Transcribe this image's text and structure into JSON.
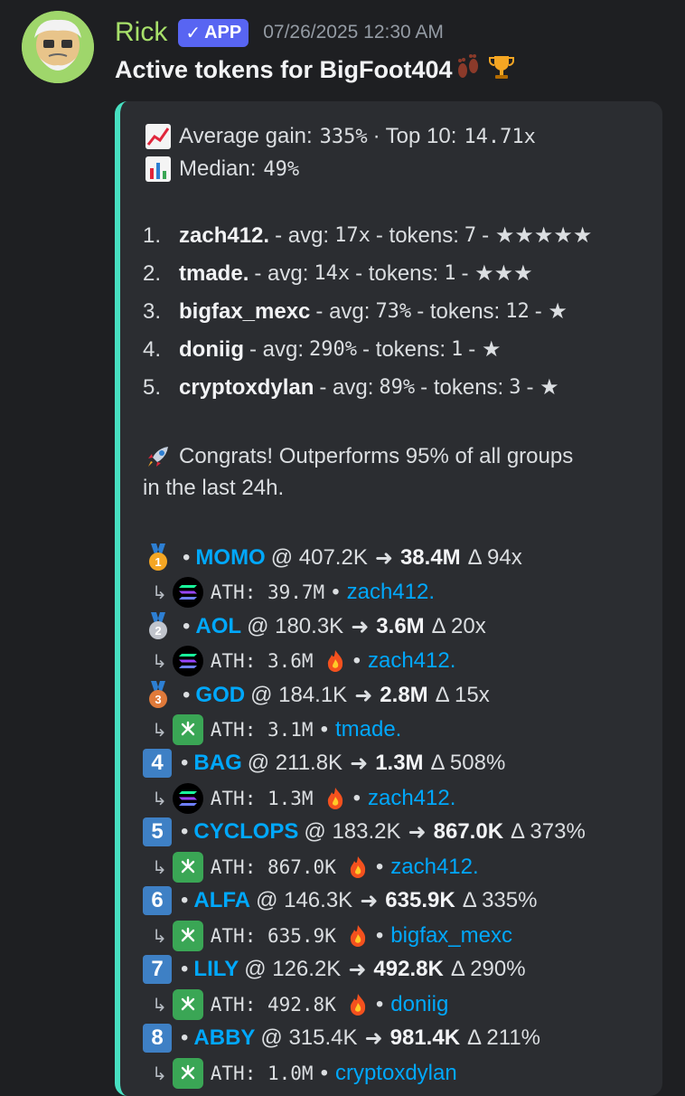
{
  "message": {
    "username": "Rick",
    "badge_label": "APP",
    "timestamp": "07/26/2025 12:30 AM",
    "content": "Active tokens for BigFoot404"
  },
  "embed": {
    "stats": {
      "avg_label": "Average gain:",
      "avg_value": "335%",
      "top10_label": "Top 10:",
      "top10_value": "14.71x",
      "median_label": "Median:",
      "median_value": "49%"
    },
    "callers": [
      {
        "rank": "1.",
        "name": "zach412.",
        "avg_label": "- avg:",
        "avg": "17x",
        "tokens_label": "- tokens:",
        "tokens": "7",
        "stars": "- ★★★★★"
      },
      {
        "rank": "2.",
        "name": "tmade.",
        "avg_label": "- avg:",
        "avg": "14x",
        "tokens_label": "- tokens:",
        "tokens": "1",
        "stars": "- ★★★"
      },
      {
        "rank": "3.",
        "name": "bigfax_mexc",
        "avg_label": "- avg:",
        "avg": "73%",
        "tokens_label": "- tokens:",
        "tokens": "12",
        "stars": "- ★"
      },
      {
        "rank": "4.",
        "name": "doniig",
        "avg_label": "- avg:",
        "avg": "290%",
        "tokens_label": "- tokens:",
        "tokens": "1",
        "stars": "- ★"
      },
      {
        "rank": "5.",
        "name": "cryptoxdylan",
        "avg_label": "- avg:",
        "avg": "89%",
        "tokens_label": "- tokens:",
        "tokens": "3",
        "stars": "- ★"
      }
    ],
    "congrats_line1": "Congrats! Outperforms 95% of all groups",
    "congrats_line2": "in the last 24h.",
    "tokens": [
      {
        "rank": "1",
        "medal": "gold",
        "name": "MOMO",
        "entry": "@ 407.2K",
        "peak": "38.4M",
        "gain": "Δ 94x",
        "chain": "sol",
        "ath": "ATH: 39.7M",
        "fire": false,
        "caller": "zach412."
      },
      {
        "rank": "2",
        "medal": "silver",
        "name": "AOL",
        "entry": "@ 180.3K",
        "peak": "3.6M",
        "gain": "Δ 20x",
        "chain": "sol",
        "ath": "ATH: 3.6M",
        "fire": true,
        "caller": "zach412."
      },
      {
        "rank": "3",
        "medal": "bronze",
        "name": "GOD",
        "entry": "@ 184.1K",
        "peak": "2.8M",
        "gain": "Δ 15x",
        "chain": "green",
        "ath": "ATH: 3.1M",
        "fire": false,
        "caller": "tmade."
      },
      {
        "rank": "4",
        "medal": "key",
        "name": "BAG",
        "entry": "@ 211.8K",
        "peak": "1.3M",
        "gain": "Δ 508%",
        "chain": "sol",
        "ath": "ATH: 1.3M",
        "fire": true,
        "caller": "zach412."
      },
      {
        "rank": "5",
        "medal": "key",
        "name": "CYCLOPS",
        "entry": "@ 183.2K",
        "peak": "867.0K",
        "gain": "Δ 373%",
        "chain": "green",
        "ath": "ATH: 867.0K",
        "fire": true,
        "caller": "zach412."
      },
      {
        "rank": "6",
        "medal": "key",
        "name": "ALFA",
        "entry": "@ 146.3K",
        "peak": "635.9K",
        "gain": "Δ 335%",
        "chain": "green",
        "ath": "ATH: 635.9K",
        "fire": true,
        "caller": "bigfax_mexc"
      },
      {
        "rank": "7",
        "medal": "key",
        "name": "LILY",
        "entry": "@ 126.2K",
        "peak": "492.8K",
        "gain": "Δ 290%",
        "chain": "green",
        "ath": "ATH: 492.8K",
        "fire": true,
        "caller": "doniig"
      },
      {
        "rank": "8",
        "medal": "key",
        "name": "ABBY",
        "entry": "@ 315.4K",
        "peak": "981.4K",
        "gain": "Δ 211%",
        "chain": "green",
        "ath": "ATH: 1.0M",
        "fire": false,
        "caller": "cryptoxdylan"
      }
    ]
  },
  "colors": {
    "accent_bar": "#47e0c1",
    "link": "#00a8fc",
    "username": "#a7e06a",
    "badge": "#5865f2"
  }
}
